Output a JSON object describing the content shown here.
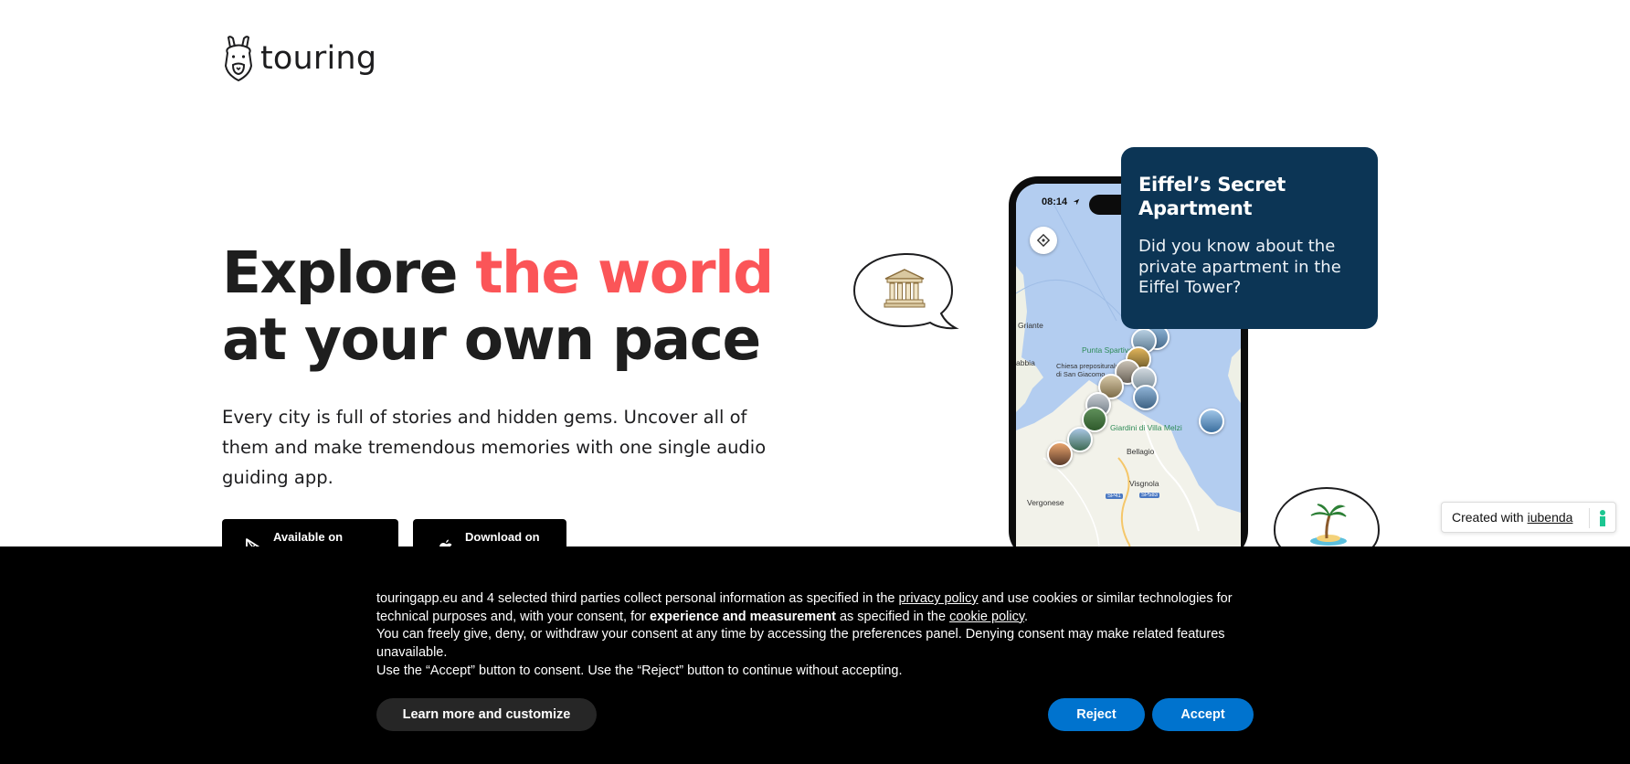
{
  "brand": {
    "name": "touring"
  },
  "hero": {
    "title_part1": "Explore ",
    "title_accent": "the world",
    "title_line2": "at your own pace",
    "subtitle": "Every city is full of stories and hidden gems. Uncover all of them and make tremendous memories with one single audio guiding app.",
    "accent_color": "#fb5558"
  },
  "store_buttons": {
    "google_play_label": "Available on",
    "app_store_label": "Download on"
  },
  "phone": {
    "status_time": "08:14",
    "map_labels": {
      "oriante": "Griante",
      "abbia": "abbia",
      "punta": "Punta Spartivento",
      "chiesa": "Chiesa prepositurale di San Giacomo",
      "giardini": "Giardini di Villa Melzi",
      "bellagio": "Bellagio",
      "visgnola": "Visgnola",
      "vergonese": "Vergonese",
      "road1": "SP41",
      "road2": "SP583"
    }
  },
  "card": {
    "title": "Eiffel’s Secret Apartment",
    "text": "Did you know about the private apartment in the Eiffel Tower?"
  },
  "iubenda": {
    "prefix": "Created with",
    "link": "iubenda"
  },
  "cookie_banner": {
    "text1_before": "touringapp.eu and 4 selected third parties collect personal information as specified in the ",
    "privacy_link": "privacy policy",
    "text1_after": " and use cookies or similar technologies for technical purposes and, with your consent, for ",
    "bold_text": "experience and measurement",
    "text1_mid": " as specified in the ",
    "cookie_link": "cookie policy",
    "text1_end": ".",
    "text2": "You can freely give, deny, or withdraw your consent at any time by accessing the preferences panel. Denying consent may make related features unavailable.",
    "text3": "Use the “Accept” button to consent. Use the “Reject” button to continue without accepting.",
    "learn_more": "Learn more and customize",
    "reject": "Reject",
    "accept": "Accept"
  },
  "colors": {
    "card_bg": "#0c3555",
    "button_blue": "#0073ce",
    "banner_bg": "#000000"
  },
  "icons": [
    "logo-llama-icon",
    "google-play-icon",
    "apple-icon",
    "temple-icon",
    "palm-island-icon",
    "locate-icon",
    "location-arrow-icon",
    "iubenda-mark-icon"
  ]
}
